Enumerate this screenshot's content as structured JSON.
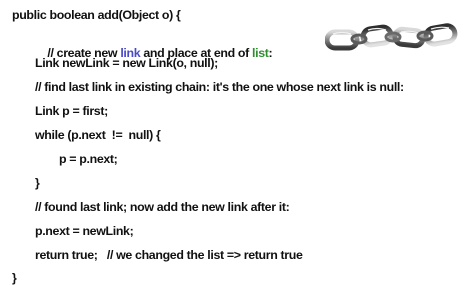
{
  "lines": [
    {
      "text": "public boolean add(Object o) {"
    },
    {
      "segments": [
        {
          "text": "// create new ",
          "style": "normal"
        },
        {
          "text": "link",
          "style": "link"
        },
        {
          "text": " and place at end of ",
          "style": "normal"
        },
        {
          "text": "list",
          "style": "list"
        },
        {
          "text": ":",
          "style": "normal"
        }
      ]
    },
    {
      "text": "Link newLink = new Link(o, null);"
    },
    {
      "text": "// find last link in existing chain: it's the one whose next link is null:"
    },
    {
      "text": "Link p = first;"
    },
    {
      "text": "while (p.next  !=  null) {"
    },
    {
      "text": "p = p.next;"
    },
    {
      "text": "}"
    },
    {
      "text": "// found last link; now add the new link after it:"
    },
    {
      "text": "p.next = newLink;"
    },
    {
      "text": "return true;   // we changed the list => return true"
    },
    {
      "text": "}"
    }
  ],
  "colors": {
    "text": "#111111",
    "link_word": "#4a4ac8",
    "list_word": "#2f8f2f"
  },
  "image": {
    "icon": "chain-links-icon"
  }
}
